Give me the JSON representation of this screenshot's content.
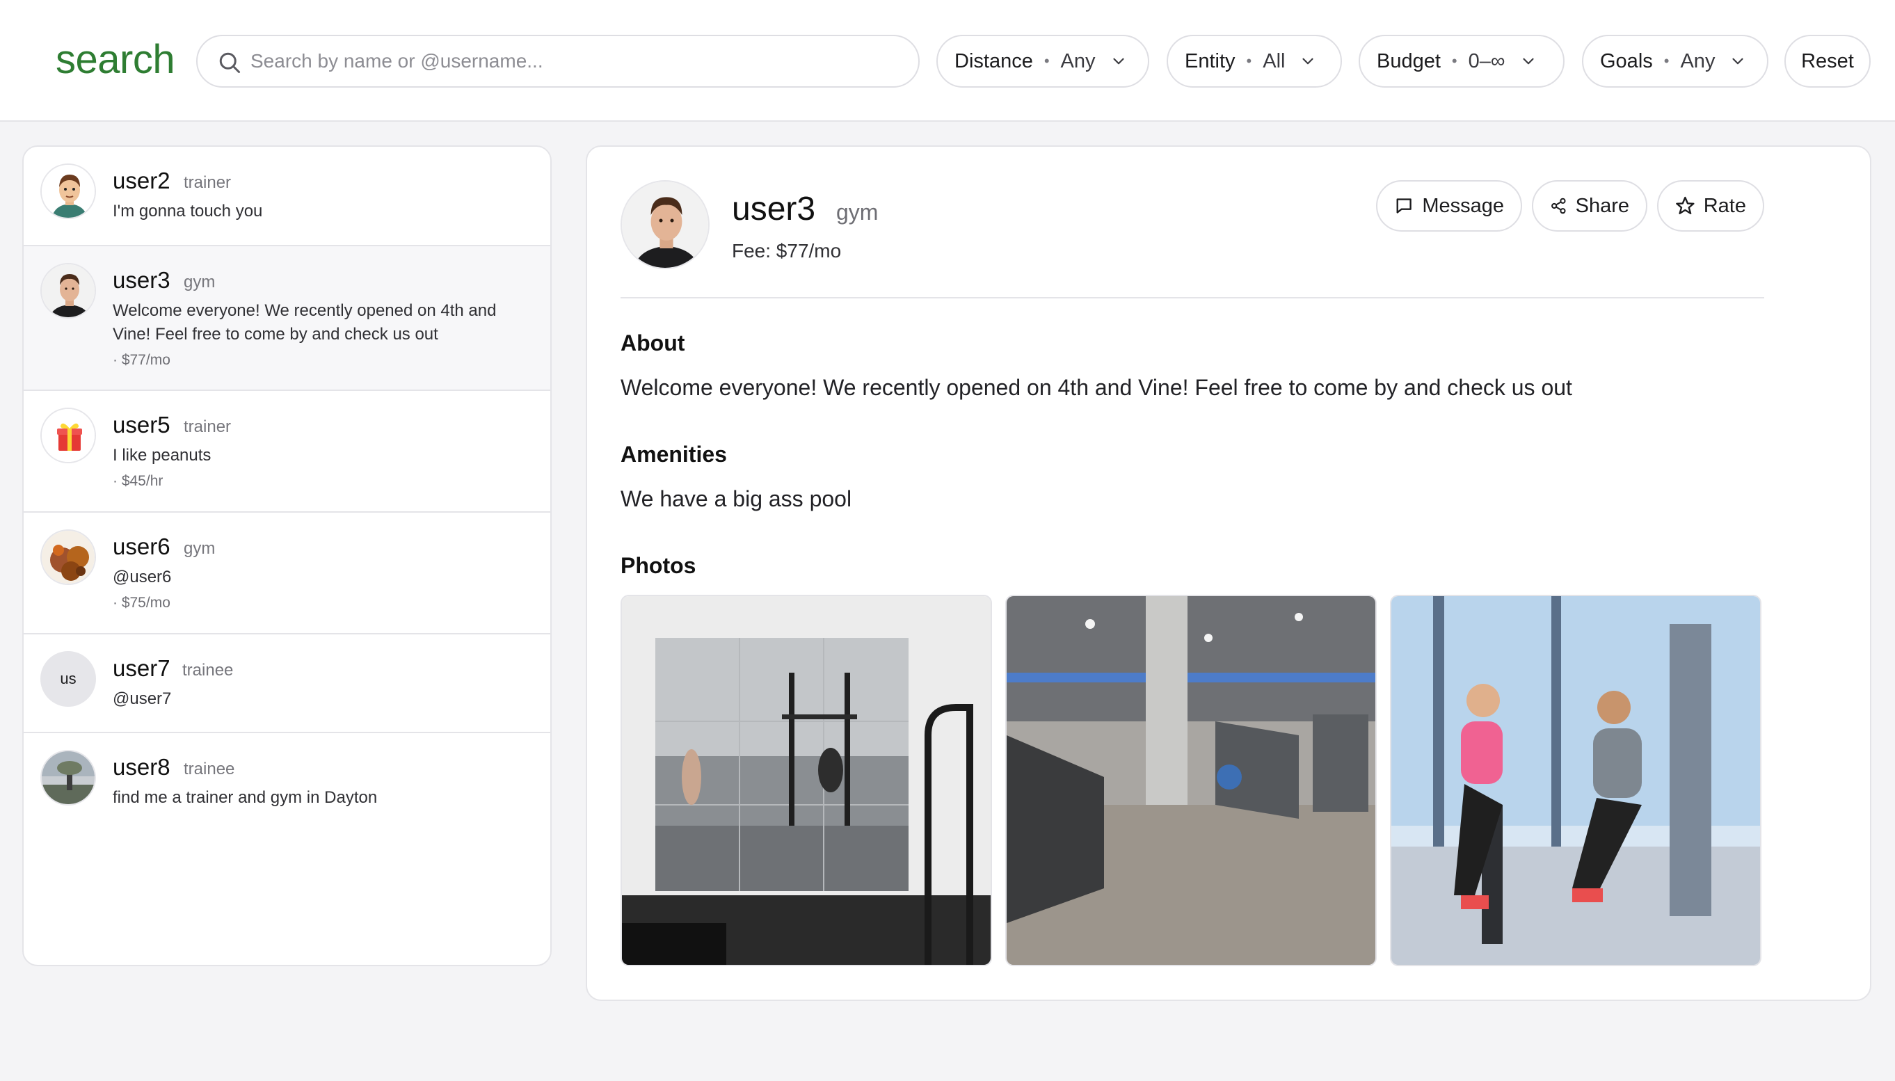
{
  "header": {
    "logo": "search",
    "search_placeholder": "Search by name or @username...",
    "filters": [
      {
        "label": "Distance",
        "value": "Any"
      },
      {
        "label": "Entity",
        "value": "All"
      },
      {
        "label": "Budget",
        "value": "0–∞"
      },
      {
        "label": "Goals",
        "value": "Any"
      }
    ],
    "reset_label": "Reset"
  },
  "results": [
    {
      "name": "user2",
      "role": "trainer",
      "text": "I'm gonna touch you",
      "price": "",
      "avatar": "cartoon-man"
    },
    {
      "name": "user3",
      "role": "gym",
      "text": "Welcome everyone! We recently opened on 4th and Vine! Feel free to come by and check us out",
      "price": "· $77/mo",
      "avatar": "photo-man",
      "selected": true
    },
    {
      "name": "user5",
      "role": "trainer",
      "text": "I like peanuts",
      "price": "· $45/hr",
      "avatar": "gift-emoji"
    },
    {
      "name": "user6",
      "role": "gym",
      "text": "@user6",
      "price": "· $75/mo",
      "avatar": "food-photo"
    },
    {
      "name": "user7",
      "role": "trainee",
      "text": "@user7",
      "price": "",
      "avatar": "initials",
      "initials": "us"
    },
    {
      "name": "user8",
      "role": "trainee",
      "text": "find me a trainer and gym in Dayton",
      "price": "",
      "avatar": "landscape-photo"
    }
  ],
  "detail": {
    "name": "user3",
    "role": "gym",
    "fee": "Fee: $77/mo",
    "actions": {
      "message": "Message",
      "share": "Share",
      "rate": "Rate"
    },
    "about_heading": "About",
    "about_text": "Welcome everyone! We recently opened on 4th and Vine! Feel free to come by and check us out",
    "amenities_heading": "Amenities",
    "amenities_text": "We have a big ass pool",
    "photos_heading": "Photos",
    "photos": [
      "gym-mirror-rack-photo",
      "gym-floor-treadmills-photo",
      "trainer-and-client-photo"
    ]
  },
  "colors": {
    "brand": "#2e7d32",
    "border": "#e4e4e8",
    "background": "#f4f4f6"
  }
}
